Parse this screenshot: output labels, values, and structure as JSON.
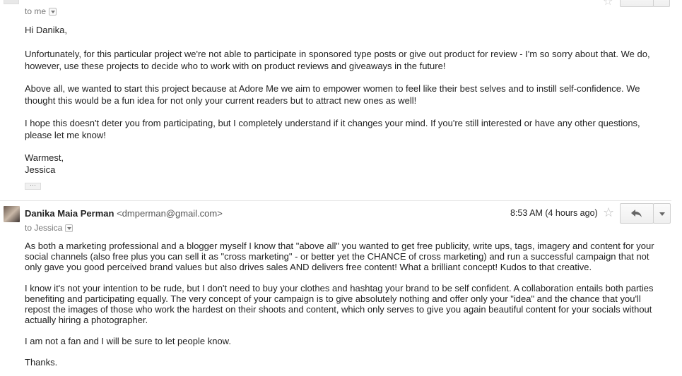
{
  "msg1": {
    "to_line": "to me",
    "greeting": "Hi Danika,",
    "paragraphs": [
      "Unfortunately, for this particular project we're not able to participate in sponsored type posts or give out product for review - I'm so sorry about that. We do, however, use these projects to decide who to work with on product reviews and giveaways in the future!",
      "Above all, we wanted to start this project because at Adore Me we aim to empower women to feel like their best selves and to instill self-confidence. We thought this would be a fun idea for not only your current readers but to attract new ones as well!",
      "I hope this doesn't deter you from participating, but I completely understand if it changes your mind. If you're still interested or have any other questions, please let me know!"
    ],
    "signoff": "Warmest,",
    "signature": "Jessica"
  },
  "msg2": {
    "sender_name": "Danika Maia Perman",
    "sender_email": "<dmperman@gmail.com>",
    "time": "8:53 AM (4 hours ago)",
    "to_line": "to Jessica",
    "paragraphs": [
      "As both a marketing professional and a blogger myself I know that \"above all\" you wanted to get free publicity, write ups, tags, imagery and content for your social channels (also free plus you can sell it as \"cross marketing\" - or better yet the CHANCE of cross marketing) and run a successful campaign that not only gave you good perceived brand values but also drives sales AND delivers free content! What a brilliant concept! Kudos to that creative.",
      "I know it's not your intention to be rude, but I don't need to buy your clothes and hashtag your brand to be self confident. A collaboration entails both parties benefiting and participating equally. The very concept of your campaign is to give absolutely nothing and offer only your \"idea\" and the chance that you'll repost the images of those who work the hardest on their shoots and content, which only serves to give you again beautiful content for your socials without actually hiring a photographer.",
      "I am not a fan and I will be sure to let people know.",
      "Thanks."
    ]
  },
  "icons": [
    "star-icon",
    "reply-icon",
    "chevron-down-icon",
    "ellipsis-icon"
  ]
}
